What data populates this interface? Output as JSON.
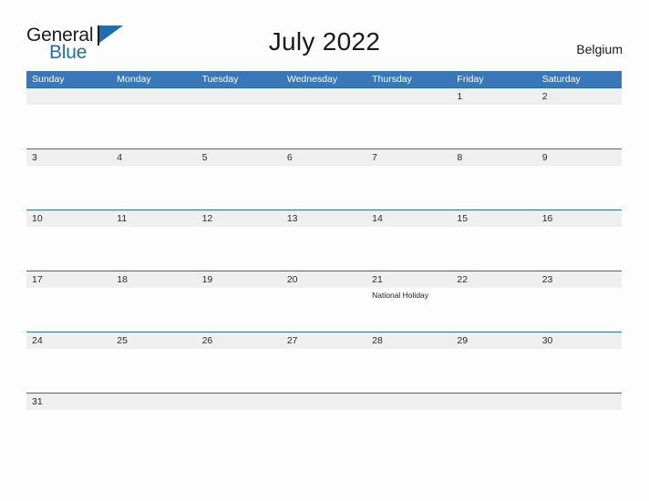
{
  "brand": {
    "name_part1": "General",
    "name_part2": "Blue",
    "logo_icon": "blue-flag-triangle",
    "color_primary": "#1f6db5",
    "color_text": "#1c1c1c"
  },
  "header": {
    "title": "July 2022",
    "country": "Belgium"
  },
  "colors": {
    "weekday_header_bg": "#3a77b8",
    "row_divider": "#2a6ca8",
    "day_band_bg": "#efefef",
    "page_bg": "#fdfdfd"
  },
  "calendar": {
    "month": "July",
    "year": "2022",
    "weekdays": [
      "Sunday",
      "Monday",
      "Tuesday",
      "Wednesday",
      "Thursday",
      "Friday",
      "Saturday"
    ],
    "weeks": [
      [
        {
          "day": "",
          "event": ""
        },
        {
          "day": "",
          "event": ""
        },
        {
          "day": "",
          "event": ""
        },
        {
          "day": "",
          "event": ""
        },
        {
          "day": "",
          "event": ""
        },
        {
          "day": "1",
          "event": ""
        },
        {
          "day": "2",
          "event": ""
        }
      ],
      [
        {
          "day": "3",
          "event": ""
        },
        {
          "day": "4",
          "event": ""
        },
        {
          "day": "5",
          "event": ""
        },
        {
          "day": "6",
          "event": ""
        },
        {
          "day": "7",
          "event": ""
        },
        {
          "day": "8",
          "event": ""
        },
        {
          "day": "9",
          "event": ""
        }
      ],
      [
        {
          "day": "10",
          "event": ""
        },
        {
          "day": "11",
          "event": ""
        },
        {
          "day": "12",
          "event": ""
        },
        {
          "day": "13",
          "event": ""
        },
        {
          "day": "14",
          "event": ""
        },
        {
          "day": "15",
          "event": ""
        },
        {
          "day": "16",
          "event": ""
        }
      ],
      [
        {
          "day": "17",
          "event": ""
        },
        {
          "day": "18",
          "event": ""
        },
        {
          "day": "19",
          "event": ""
        },
        {
          "day": "20",
          "event": ""
        },
        {
          "day": "21",
          "event": "National Holiday"
        },
        {
          "day": "22",
          "event": ""
        },
        {
          "day": "23",
          "event": ""
        }
      ],
      [
        {
          "day": "24",
          "event": ""
        },
        {
          "day": "25",
          "event": ""
        },
        {
          "day": "26",
          "event": ""
        },
        {
          "day": "27",
          "event": ""
        },
        {
          "day": "28",
          "event": ""
        },
        {
          "day": "29",
          "event": ""
        },
        {
          "day": "30",
          "event": ""
        }
      ],
      [
        {
          "day": "31",
          "event": ""
        },
        {
          "day": "",
          "event": ""
        },
        {
          "day": "",
          "event": ""
        },
        {
          "day": "",
          "event": ""
        },
        {
          "day": "",
          "event": ""
        },
        {
          "day": "",
          "event": ""
        },
        {
          "day": "",
          "event": ""
        }
      ]
    ]
  }
}
